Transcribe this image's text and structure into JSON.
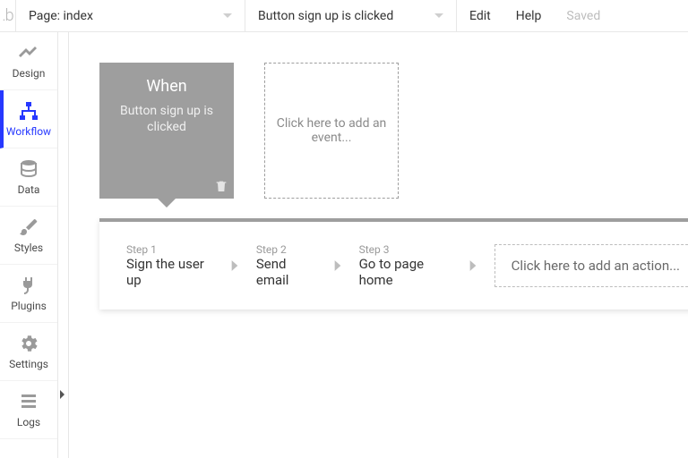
{
  "topbar": {
    "logo": ".b",
    "page_dropdown_label": "Page: index",
    "workflow_dropdown_label": "Button sign up is clicked",
    "edit": "Edit",
    "help": "Help",
    "status": "Saved"
  },
  "sidebar": {
    "items": [
      {
        "label": "Design"
      },
      {
        "label": "Workflow"
      },
      {
        "label": "Data"
      },
      {
        "label": "Styles"
      },
      {
        "label": "Plugins"
      },
      {
        "label": "Settings"
      },
      {
        "label": "Logs"
      }
    ]
  },
  "event": {
    "title": "When",
    "subtitle": "Button sign up is clicked"
  },
  "add_event": "Click here to add an event...",
  "steps": [
    {
      "label": "Step 1",
      "name": "Sign the user up"
    },
    {
      "label": "Step 2",
      "name": "Send email"
    },
    {
      "label": "Step 3",
      "name": "Go to page home"
    }
  ],
  "add_action": "Click here to add an action..."
}
